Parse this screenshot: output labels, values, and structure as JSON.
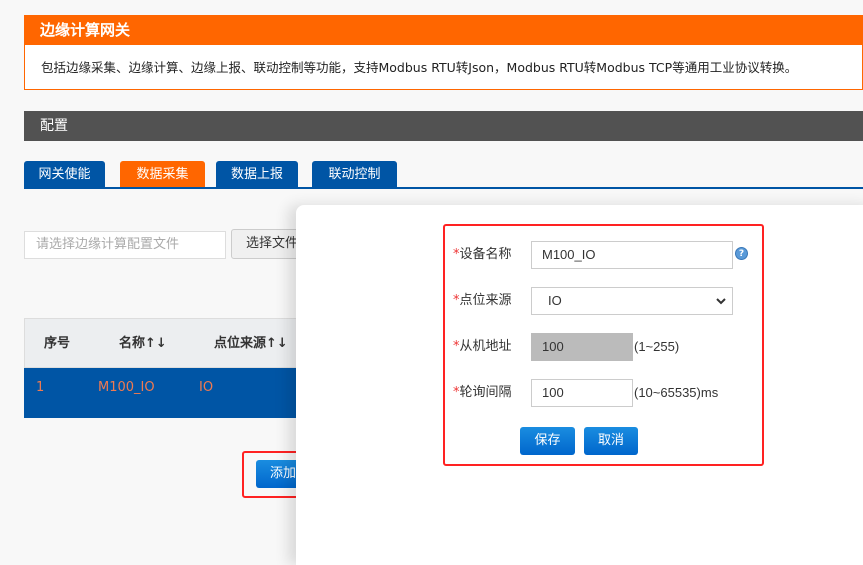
{
  "header": {
    "title": "边缘计算网关",
    "description": "包括边缘采集、边缘计算、边缘上报、联动控制等功能，支持Modbus RTU转Json，Modbus RTU转Modbus TCP等通用工业协议转换。"
  },
  "config": {
    "title": "配置"
  },
  "tabs": [
    {
      "label": "网关使能"
    },
    {
      "label": "数据采集"
    },
    {
      "label": "数据上报"
    },
    {
      "label": "联动控制"
    }
  ],
  "file": {
    "placeholder": "请选择边缘计算配置文件",
    "button": "选择文件"
  },
  "table": {
    "headers": [
      "序号",
      "名称↑↓",
      "点位来源↑↓"
    ],
    "rows": [
      [
        "1",
        "M100_IO",
        "IO"
      ]
    ]
  },
  "add_button": "添加",
  "form": {
    "device_name": {
      "label": "设备名称",
      "value": "M100_IO"
    },
    "source": {
      "label": "点位来源",
      "value": "IO"
    },
    "slave": {
      "label": "从机地址",
      "value": "100",
      "hint": "(1~255)"
    },
    "interval": {
      "label": "轮询间隔",
      "value": "100",
      "hint": "(10~65535)ms"
    },
    "required_mark": "*",
    "help": "?",
    "save": "保存",
    "cancel": "取消"
  },
  "colors": {
    "orange": "#ff6600",
    "blue": "#0055a5",
    "annotation": "#ff2222"
  }
}
